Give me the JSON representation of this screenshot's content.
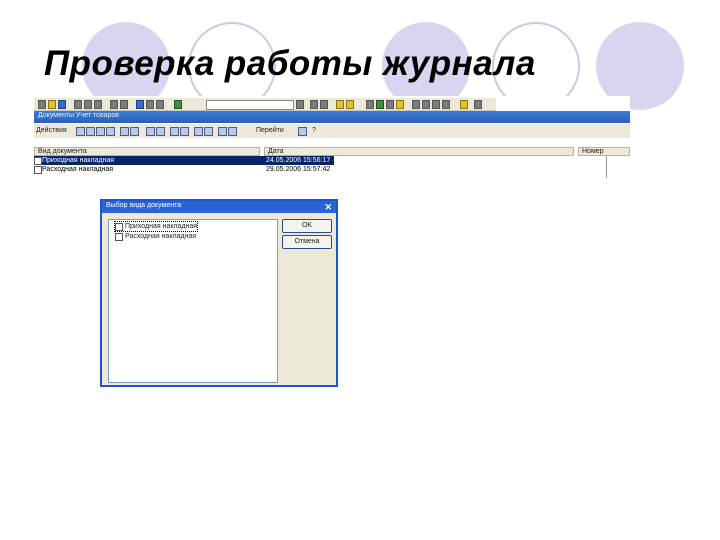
{
  "slide": {
    "title": "Проверка работы журнала"
  },
  "app": {
    "document_window_title": "Документы Учет товаров",
    "toolbar2": {
      "actions_label": "Действия",
      "goto_label": "Перейти",
      "help_label": "?"
    },
    "journal": {
      "columns": [
        "Вид документа",
        "Дата",
        "Номер"
      ],
      "rows": [
        {
          "type": "Приходная накладная",
          "date": "24.05.2006 15:56:17",
          "selected": true
        },
        {
          "type": "Расходная накладная",
          "date": "29.05.2006 15:57:42",
          "selected": false
        }
      ]
    }
  },
  "dialog": {
    "title": "Выбор вида документа",
    "close_label": "✕",
    "items": [
      {
        "label": "Приходная накладная",
        "focused": true
      },
      {
        "label": "Расходная накладная",
        "focused": false
      }
    ],
    "ok_label": "OK",
    "cancel_label": "Отмена"
  },
  "colors": {
    "circle_fill": "#d6d6f0",
    "circle_ring": "#c9c9ea",
    "titlebar_blue": "#2a63d6",
    "selection_navy": "#0a246a"
  }
}
